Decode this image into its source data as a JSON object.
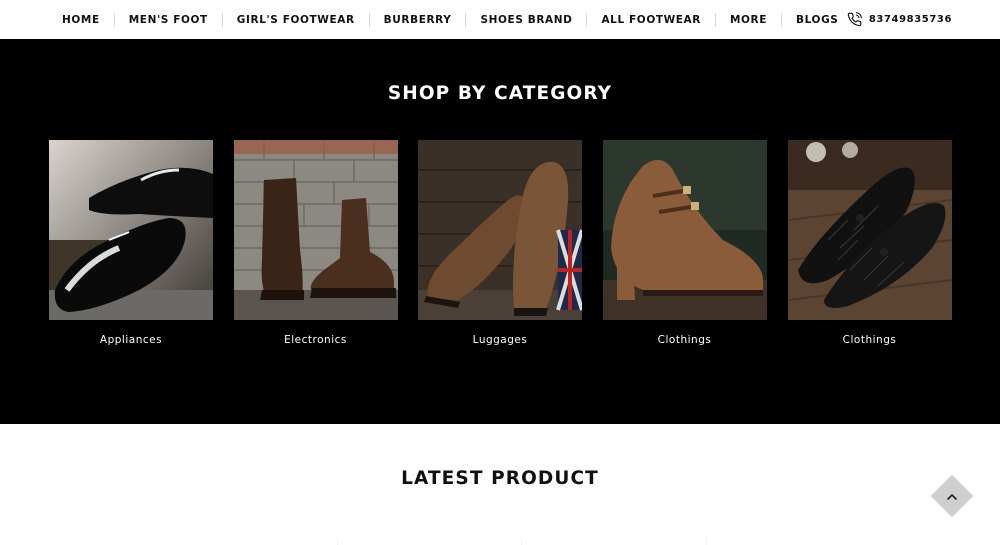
{
  "nav": {
    "items": [
      "HOME",
      "MEN'S FOOT",
      "GIRL'S FOOTWEAR",
      "BURBERRY",
      "SHOES BRAND",
      "ALL FOOTWEAR",
      "MORE",
      "BLOGS"
    ],
    "phone": "83749835736",
    "phone_icon": "phone-icon"
  },
  "categories": {
    "title": "SHOP BY CATEGORY",
    "items": [
      {
        "label": "Appliances"
      },
      {
        "label": "Electronics"
      },
      {
        "label": "Luggages"
      },
      {
        "label": "Clothings"
      },
      {
        "label": "Clothings"
      }
    ]
  },
  "latest": {
    "title": "LATEST PRODUCT"
  },
  "back_to_top": {
    "icon": "chevron-up-icon"
  },
  "colors": {
    "nav_bg": "#ffffff",
    "category_bg": "#000000",
    "back_to_top_bg": "#cfcfcf"
  }
}
